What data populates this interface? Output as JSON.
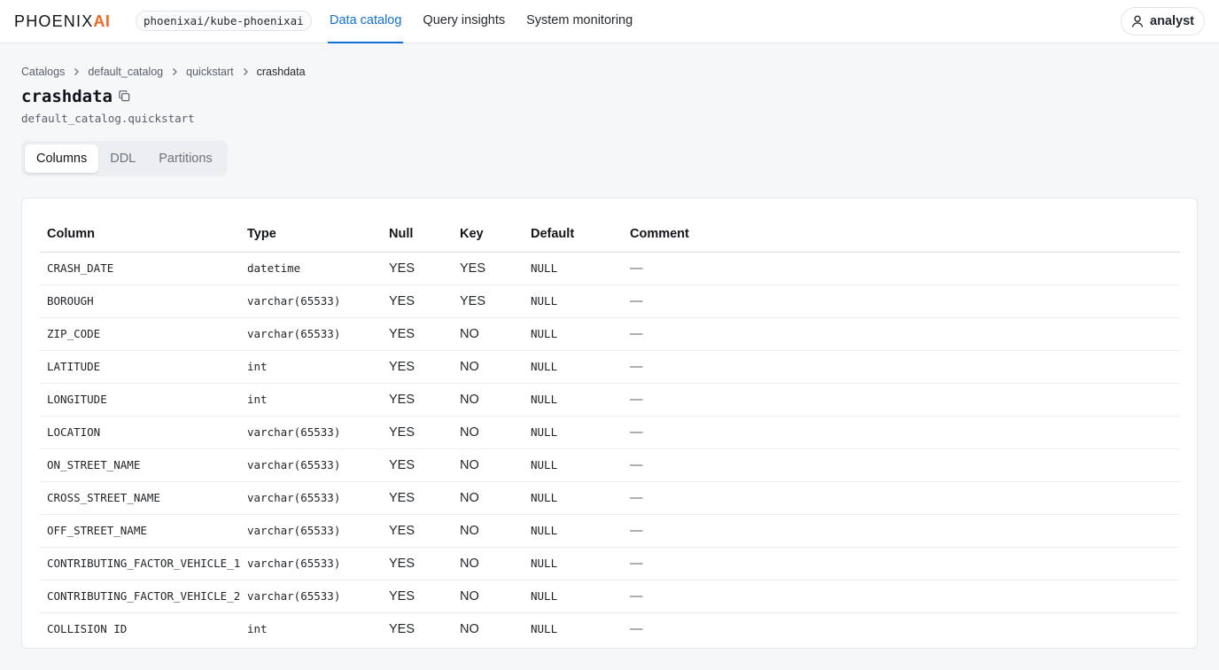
{
  "brand": {
    "logo_text": "PHOENIX",
    "logo_accent": "AI",
    "accent_color": "#f26522"
  },
  "cluster": "phoenixai/kube-phoenixai",
  "nav": {
    "items": [
      {
        "label": "Data catalog",
        "active": true
      },
      {
        "label": "Query insights",
        "active": false
      },
      {
        "label": "System monitoring",
        "active": false
      }
    ],
    "active_color": "#1170d3"
  },
  "user": {
    "name": "analyst",
    "icon": "user-icon"
  },
  "breadcrumb": [
    "Catalogs",
    "default_catalog",
    "quickstart",
    "crashdata"
  ],
  "page": {
    "title": "crashdata",
    "subtitle": "default_catalog.quickstart",
    "copy_icon": "copy-icon"
  },
  "tabs": [
    {
      "label": "Columns",
      "active": true
    },
    {
      "label": "DDL",
      "active": false
    },
    {
      "label": "Partitions",
      "active": false
    }
  ],
  "table": {
    "headers": [
      "Column",
      "Type",
      "Null",
      "Key",
      "Default",
      "Comment"
    ],
    "rows": [
      [
        "CRASH_DATE",
        "datetime",
        "YES",
        "YES",
        "NULL",
        "—"
      ],
      [
        "BOROUGH",
        "varchar(65533)",
        "YES",
        "YES",
        "NULL",
        "—"
      ],
      [
        "ZIP_CODE",
        "varchar(65533)",
        "YES",
        "NO",
        "NULL",
        "—"
      ],
      [
        "LATITUDE",
        "int",
        "YES",
        "NO",
        "NULL",
        "—"
      ],
      [
        "LONGITUDE",
        "int",
        "YES",
        "NO",
        "NULL",
        "—"
      ],
      [
        "LOCATION",
        "varchar(65533)",
        "YES",
        "NO",
        "NULL",
        "—"
      ],
      [
        "ON_STREET_NAME",
        "varchar(65533)",
        "YES",
        "NO",
        "NULL",
        "—"
      ],
      [
        "CROSS_STREET_NAME",
        "varchar(65533)",
        "YES",
        "NO",
        "NULL",
        "—"
      ],
      [
        "OFF_STREET_NAME",
        "varchar(65533)",
        "YES",
        "NO",
        "NULL",
        "—"
      ],
      [
        "CONTRIBUTING_FACTOR_VEHICLE_1",
        "varchar(65533)",
        "YES",
        "NO",
        "NULL",
        "—"
      ],
      [
        "CONTRIBUTING_FACTOR_VEHICLE_2",
        "varchar(65533)",
        "YES",
        "NO",
        "NULL",
        "—"
      ],
      [
        "COLLISION_ID",
        "int",
        "YES",
        "NO",
        "NULL",
        "—"
      ]
    ]
  }
}
